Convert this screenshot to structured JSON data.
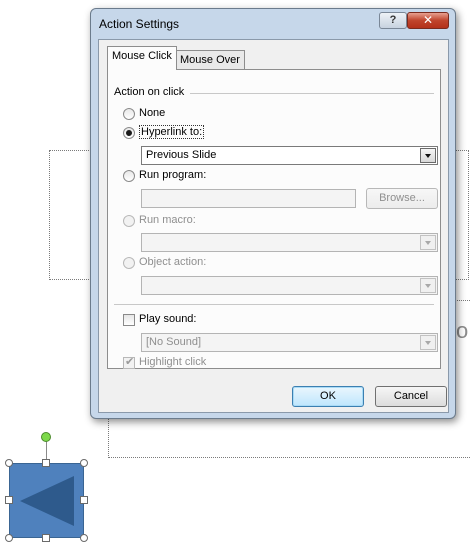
{
  "background": {
    "placeholder_text": "o"
  },
  "dialog": {
    "title": "Action Settings",
    "help_label": "?",
    "close_label": "✕",
    "tabs": [
      {
        "label": "Mouse Click",
        "selected": true
      },
      {
        "label": "Mouse Over",
        "selected": false
      }
    ],
    "action_group_label": "Action on click",
    "options": {
      "none": "None",
      "hyperlink": "Hyperlink to:",
      "run_program": "Run program:",
      "run_macro": "Run macro:",
      "object_action": "Object action:"
    },
    "selected_option": "hyperlink",
    "hyperlink_value": "Previous Slide",
    "browse_label": "Browse...",
    "play_sound_label": "Play sound:",
    "play_sound_checked": false,
    "sound_value": "[No Sound]",
    "highlight_click_label": "Highlight click",
    "highlight_click_checked": true,
    "ok_label": "OK",
    "cancel_label": "Cancel"
  },
  "colors": {
    "dialog_frame": "#c6d7ea",
    "shape_fill": "#4f81bd",
    "shape_arrow": "#2e5a8c",
    "close_button": "#c0442c"
  }
}
